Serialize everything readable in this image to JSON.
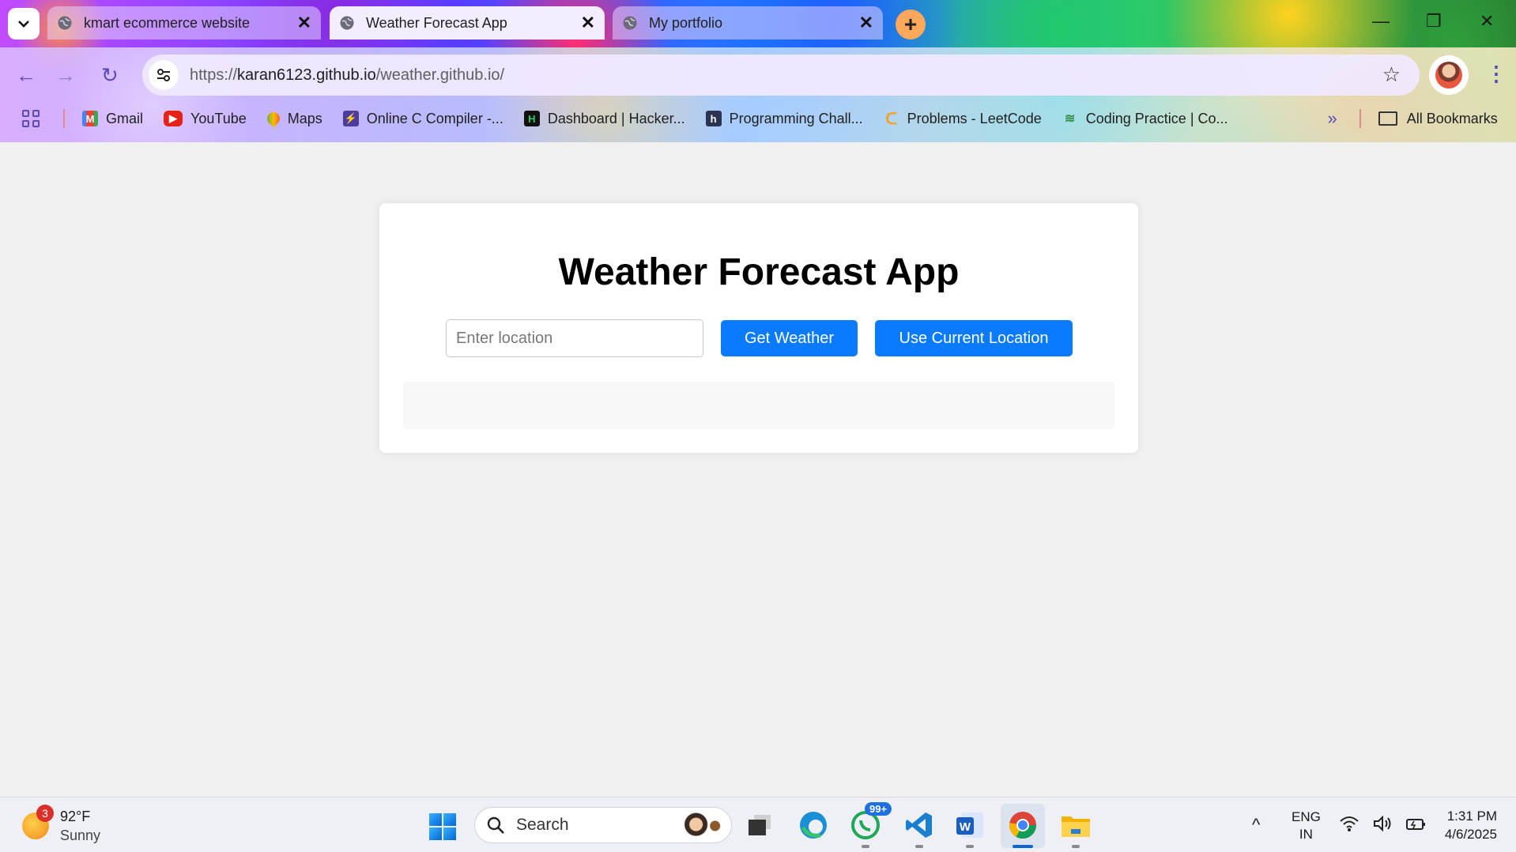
{
  "browser": {
    "tabs": [
      {
        "label": "kmart ecommerce website",
        "active": false
      },
      {
        "label": "Weather Forecast App",
        "active": true
      },
      {
        "label": "My portfolio",
        "active": false
      }
    ],
    "new_tab_symbol": "+",
    "url_prefix": "https://",
    "url_host": "karan6123.github.io",
    "url_path": "/weather.github.io/",
    "bookmarks": [
      {
        "label": "Gmail",
        "icon": "gmail-icon"
      },
      {
        "label": "YouTube",
        "icon": "youtube-icon"
      },
      {
        "label": "Maps",
        "icon": "maps-icon"
      },
      {
        "label": "Online C Compiler -...",
        "icon": "compiler-icon"
      },
      {
        "label": "Dashboard | Hacker...",
        "icon": "hackerrank-icon"
      },
      {
        "label": "Programming Chall...",
        "icon": "hackerearth-icon"
      },
      {
        "label": "Problems - LeetCode",
        "icon": "leetcode-icon"
      },
      {
        "label": "Coding Practice | Co...",
        "icon": "gfg-icon"
      }
    ],
    "all_bookmarks_label": "All Bookmarks"
  },
  "app": {
    "title": "Weather Forecast App",
    "location_input_value": "",
    "location_placeholder": "Enter location",
    "get_weather_label": "Get Weather",
    "use_location_label": "Use Current Location",
    "result_text": "",
    "accent_color": "#0a7bff"
  },
  "taskbar": {
    "weather_badge": "3",
    "temperature": "92°F",
    "condition": "Sunny",
    "search_label": "Search",
    "whatsapp_badge": "99+",
    "lang_line1": "ENG",
    "lang_line2": "IN",
    "time": "1:31 PM",
    "date": "4/6/2025"
  }
}
